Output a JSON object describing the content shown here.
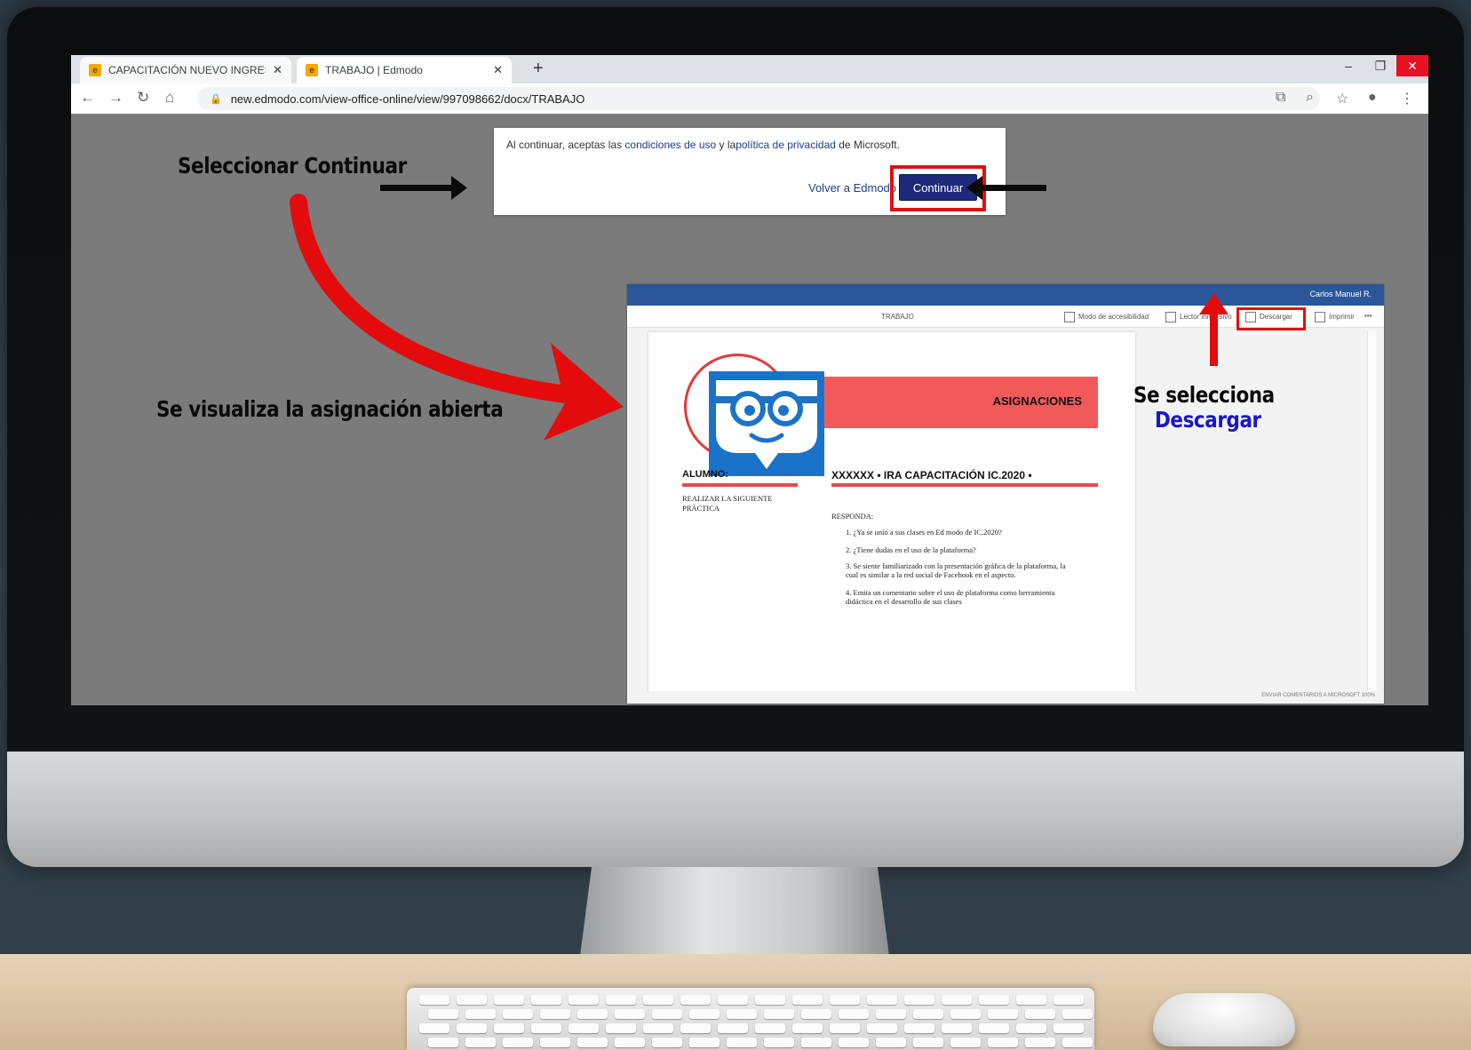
{
  "browser": {
    "tabs": [
      {
        "title": "CAPACITACIÓN NUEVO INGRESO",
        "active": false
      },
      {
        "title": "TRABAJO | Edmodo",
        "active": true
      }
    ],
    "new_tab": "+",
    "close_glyph": "✕",
    "url": "new.edmodo.com/view-office-online/view/997098662/docx/TRABAJO",
    "window_controls": {
      "minimize": "–",
      "restore": "❐",
      "close": "✕"
    }
  },
  "dialog": {
    "text_prefix": "Al continuar, aceptas las ",
    "link_terms": "condiciones de uso",
    "text_and": " y la",
    "link_privacy": "política de privacidad",
    "text_suffix": " de Microsoft.",
    "back_link": "Volver a Edmodo",
    "continue_label": "Continuar"
  },
  "annotations": {
    "select_continue": "Seleccionar Continuar",
    "open_assignment": "Se visualiza la asignación abierta",
    "se_selecciona": "Se selecciona",
    "descargar": "Descargar"
  },
  "doc_viewer": {
    "user": "Carlos Manuel R.",
    "doc_name": "TRABAJO",
    "ribbon": [
      "Modo de accesibilidad",
      "Lector inmersivo",
      "Descargar",
      "Imprimir",
      "•••"
    ],
    "footer": "ENVIAR COMENTARIOS A MICROSOFT    100%",
    "page": {
      "banner": "ASIGNACIONES",
      "alumno": "ALUMNO:",
      "course": "XXXXXX • IRA CAPACITACIÓN IC.2020  •",
      "realizar": "REALIZAR LA SIGUIENTE PRÁCTICA",
      "responda": "RESPONDA:",
      "questions": [
        "1.   ¿Ya se unió a sus clases en Ed modo de IC.2020?",
        "2.   ¿Tiene dudas en el uso de la plataforma?",
        "3.   Se siente familiarizado con la presentación gráfica de la plataforma, la cual es similar a la red social de Facebook en el aspecto.",
        "4.   Emita un comentario sobre el uso de plataforma como herramienta didáctica en el desarrollo de sus clases"
      ]
    }
  },
  "colors": {
    "accent_red": "#e01010",
    "continue_blue": "#1d2a7a",
    "word_blue": "#2b579a",
    "descargar_text": "#1a17c9"
  }
}
